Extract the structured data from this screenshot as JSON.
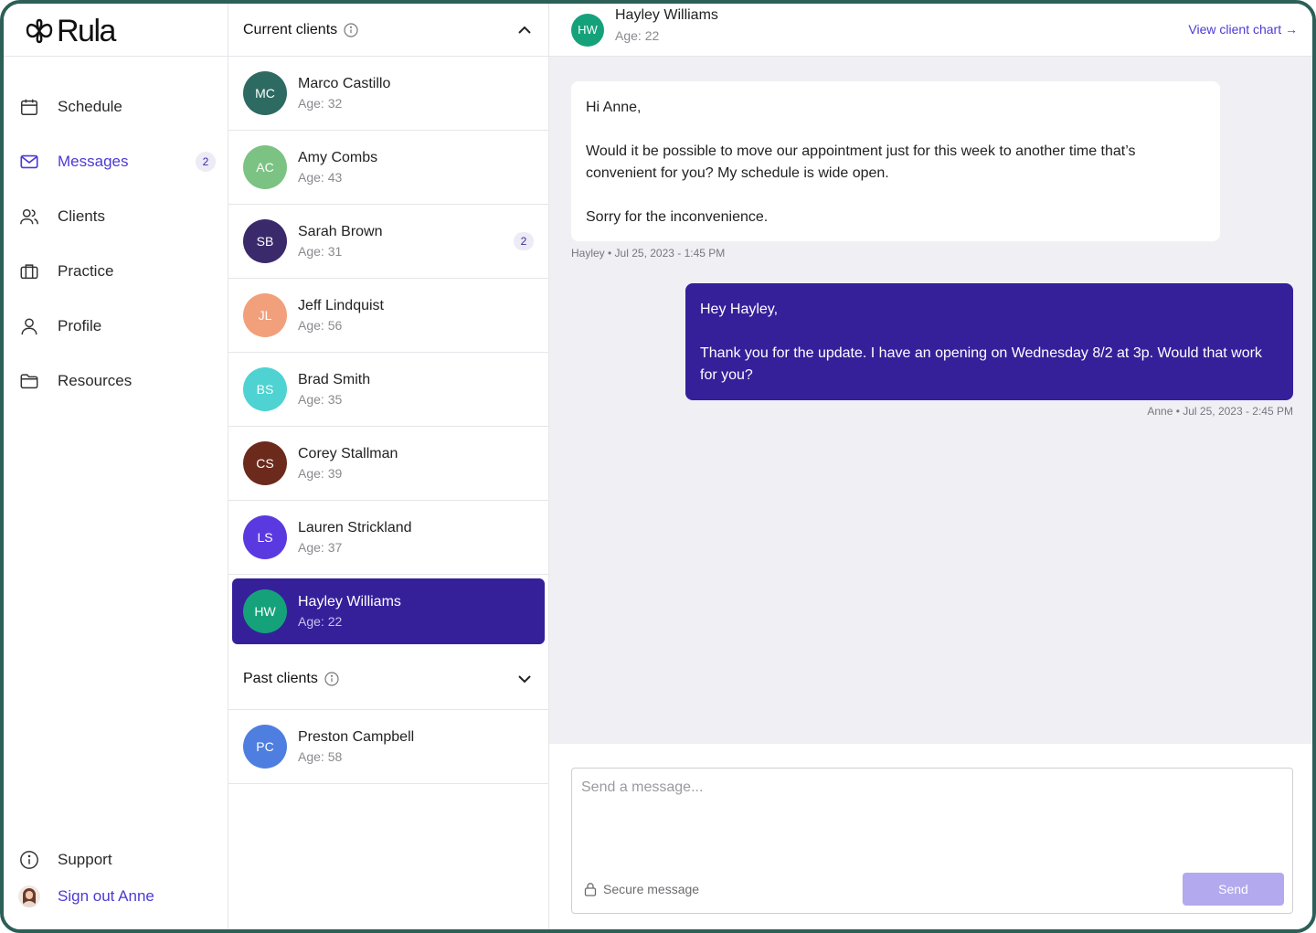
{
  "brand": {
    "name": "Rula"
  },
  "sidebar": {
    "items": [
      {
        "label": "Schedule",
        "icon": "calendar-icon"
      },
      {
        "label": "Messages",
        "icon": "mail-icon",
        "badge": "2",
        "active": true
      },
      {
        "label": "Clients",
        "icon": "users-icon"
      },
      {
        "label": "Practice",
        "icon": "briefcase-icon"
      },
      {
        "label": "Profile",
        "icon": "user-icon"
      },
      {
        "label": "Resources",
        "icon": "folder-icon"
      }
    ],
    "support_label": "Support",
    "signout_label": "Sign out Anne"
  },
  "clients": {
    "current_title": "Current clients",
    "past_title": "Past clients",
    "current": [
      {
        "initials": "MC",
        "name": "Marco Castillo",
        "age": "Age: 32",
        "color": "#2d6a62"
      },
      {
        "initials": "AC",
        "name": "Amy Combs",
        "age": "Age: 43",
        "color": "#7cc383"
      },
      {
        "initials": "SB",
        "name": "Sarah Brown",
        "age": "Age: 31",
        "color": "#3a2a6b",
        "badge": "2"
      },
      {
        "initials": "JL",
        "name": "Jeff Lindquist",
        "age": "Age: 56",
        "color": "#f2a07b"
      },
      {
        "initials": "BS",
        "name": "Brad Smith",
        "age": "Age: 35",
        "color": "#4fd2d2"
      },
      {
        "initials": "CS",
        "name": "Corey Stallman",
        "age": "Age: 39",
        "color": "#6b2a1c"
      },
      {
        "initials": "LS",
        "name": "Lauren Strickland",
        "age": "Age: 37",
        "color": "#5a3ae0"
      },
      {
        "initials": "HW",
        "name": "Hayley Williams",
        "age": "Age: 22",
        "color": "#15a27a",
        "selected": true
      }
    ],
    "past": [
      {
        "initials": "PC",
        "name": "Preston Campbell",
        "age": "Age: 58",
        "color": "#4e7fe0"
      }
    ]
  },
  "conversation": {
    "client_initials": "HW",
    "client_name": "Hayley Williams",
    "client_age": "Age: 22",
    "client_color": "#15a27a",
    "view_chart_label": "View client chart →",
    "incoming": {
      "greeting": "Hi Anne,",
      "body": "Would it be possible to move our appointment just for this week to another time that’s convenient for you? My schedule is wide open.",
      "closing": "Sorry for the inconvenience.",
      "meta": "Hayley • Jul 25, 2023 - 1:45 PM"
    },
    "outgoing": {
      "greeting": "Hey Hayley,",
      "body": "Thank you for the update. I have an opening on Wednesday 8/2 at 3p. Would that work for you?",
      "meta": "Anne • Jul 25, 2023 - 2:45 PM"
    },
    "composer": {
      "placeholder": "Send a message...",
      "value": "",
      "secure_label": "Secure message",
      "send_label": "Send"
    }
  },
  "colors": {
    "accent": "#4b3ad6",
    "selected_bg": "#35209a",
    "frame_border": "#2b5f58",
    "thread_bg": "#f0eff4",
    "send_disabled": "#b3a9ee"
  }
}
